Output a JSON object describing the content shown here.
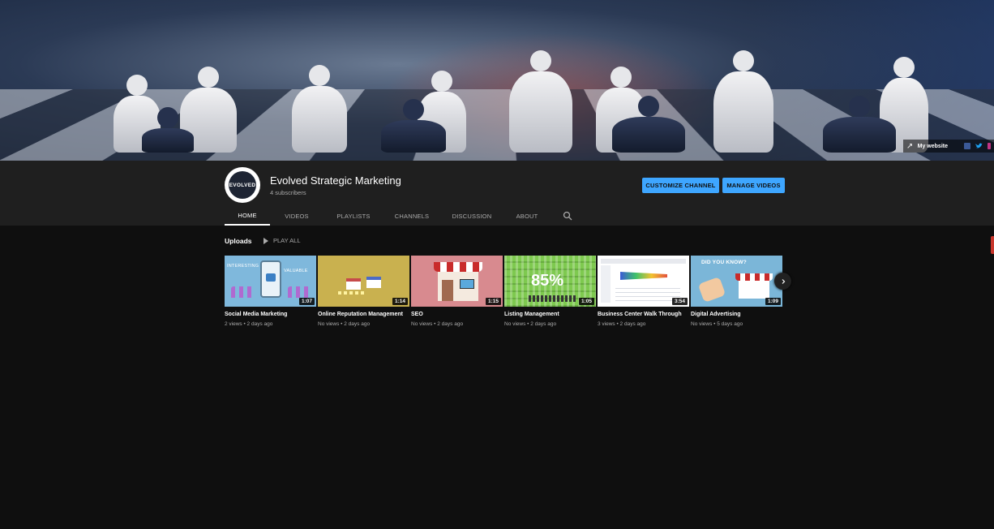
{
  "banner": {
    "links": {
      "website_label": "My website",
      "icons": [
        "link-icon",
        "facebook-icon",
        "twitter-icon",
        "instagram-icon"
      ]
    }
  },
  "channel": {
    "avatar_text": "EVOLVED",
    "title": "Evolved Strategic Marketing",
    "subscribers": "4 subscribers"
  },
  "actions": {
    "customize": "CUSTOMIZE CHANNEL",
    "manage": "MANAGE VIDEOS",
    "accent": "#3ea6ff"
  },
  "tabs": [
    "HOME",
    "VIDEOS",
    "PLAYLISTS",
    "CHANNELS",
    "DISCUSSION",
    "ABOUT"
  ],
  "uploads": {
    "title": "Uploads",
    "play_all": "PLAY ALL",
    "videos": [
      {
        "title": "Social Media Marketing",
        "meta": "2 views • 2 days ago",
        "duration": "1:07",
        "thumb_labels": [
          "INTERESTING",
          "VALUABLE"
        ]
      },
      {
        "title": "Online Reputation Management",
        "meta": "No views • 2 days ago",
        "duration": "1:14"
      },
      {
        "title": "SEO",
        "meta": "No views • 2 days ago",
        "duration": "1:15"
      },
      {
        "title": "Listing Management",
        "meta": "No views • 2 days ago",
        "duration": "1:05",
        "thumb_text": "85%"
      },
      {
        "title": "Business Center Walk Through",
        "meta": "3 views • 2 days ago",
        "duration": "3:54"
      },
      {
        "title": "Digital Advertising",
        "meta": "No views • 5 days ago",
        "duration": "1:09",
        "thumb_text": "DID YOU KNOW?"
      }
    ]
  }
}
